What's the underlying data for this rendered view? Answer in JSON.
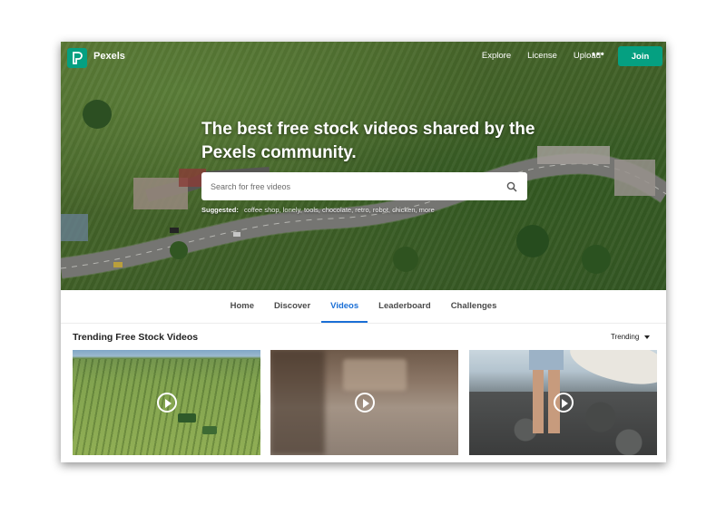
{
  "nav": {
    "brand": "Pexels",
    "links": [
      "Explore",
      "License",
      "Upload"
    ],
    "more": "•••",
    "join_label": "Join"
  },
  "hero": {
    "headline": "The best free stock videos shared by the Pexels community.",
    "search_placeholder": "Search for free videos",
    "suggested_label": "Suggested:",
    "suggested_terms": "coffee shop, lonely, tools, chocolate, retro, robot, chicken, more"
  },
  "tabs": [
    "Home",
    "Discover",
    "Videos",
    "Leaderboard",
    "Challenges"
  ],
  "active_tab": "Videos",
  "section": {
    "title": "Trending Free Stock Videos",
    "sort_label": "Trending"
  },
  "colors": {
    "brand": "#05a081",
    "active_tab": "#1a6fd6"
  },
  "icons": {
    "logo": "pexels-logo-icon",
    "search": "search-icon",
    "play": "play-icon",
    "more": "more-dots-icon",
    "caret": "caret-down-icon"
  }
}
